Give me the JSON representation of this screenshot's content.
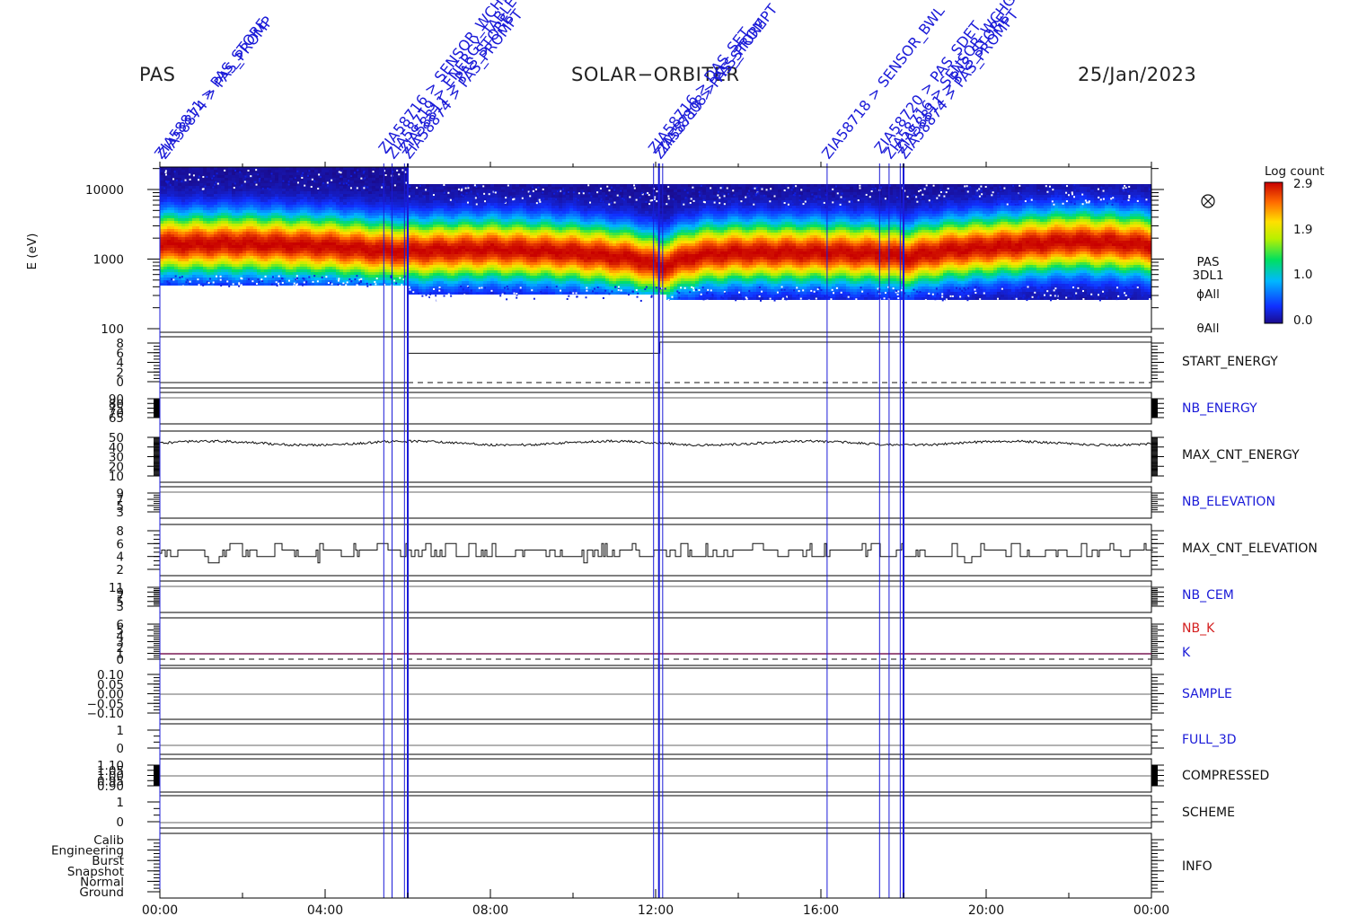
{
  "header": {
    "left": "PAS",
    "center": "SOLAR−ORBITER",
    "right": "25/Jan/2023"
  },
  "colors": {
    "axis": "#000000",
    "command_lines": "#1a1ad8",
    "label_black": "#111111",
    "label_blue": "#1a1ad8",
    "label_red": "#d42020",
    "k_line": "#7a1a55"
  },
  "chart_data": {
    "type": "heatmap",
    "time_axis": {
      "range": [
        "00:00",
        "24:00"
      ],
      "tick_labels": [
        "00:00",
        "04:00",
        "08:00",
        "12:00",
        "16:00",
        "20:00",
        "00:00"
      ]
    },
    "spectrogram": {
      "ylabel": "E (eV)",
      "scale": "log",
      "ylim": [
        100,
        20000
      ],
      "tick_labels": [
        "10000",
        "1000",
        "100"
      ],
      "side_labels": [
        "PAS",
        "3DL1",
        "ϕAll",
        "θAll"
      ],
      "side_icon": "circled-x-icon",
      "colorbar": {
        "title": "Log count",
        "range": [
          0.0,
          2.9
        ],
        "tick_labels": [
          "2.9",
          "1.9",
          "1.0",
          "0.0"
        ],
        "colormap": "rainbow"
      },
      "peak_energy_eV": {
        "hours": [
          0,
          2,
          4,
          5.5,
          8,
          10,
          11.5,
          12.1,
          13,
          14,
          16,
          17.5,
          18,
          19,
          20,
          21,
          22,
          23,
          24
        ],
        "values": [
          1700,
          1750,
          1600,
          1350,
          1450,
          1300,
          1050,
          800,
          1200,
          1300,
          1300,
          1250,
          1100,
          1400,
          1550,
          1700,
          1900,
          1800,
          1650
        ]
      }
    },
    "panels": [
      {
        "label": "START_ENERGY",
        "label_color": "#111111",
        "tick_labels": [
          "8",
          "6",
          "4",
          "2",
          "0"
        ],
        "ylim": [
          0,
          8
        ]
      },
      {
        "label": "NB_ENERGY",
        "label_color": "#1a1ad8",
        "tick_labels": [
          "90",
          "80",
          "75",
          "70",
          "65"
        ],
        "ylim": [
          64,
          91
        ]
      },
      {
        "label": "MAX_CNT_ENERGY",
        "label_color": "#111111",
        "tick_labels": [
          "50",
          "40",
          "30",
          "20",
          "10"
        ],
        "ylim": [
          10,
          50
        ]
      },
      {
        "label": "NB_ELEVATION",
        "label_color": "#1a1ad8",
        "tick_labels": [
          "9",
          "7",
          "5",
          "3"
        ],
        "ylim": [
          3,
          9
        ]
      },
      {
        "label": "MAX_CNT_ELEVATION",
        "label_color": "#111111",
        "tick_labels": [
          "8",
          "6",
          "4",
          "2"
        ],
        "ylim": [
          2,
          8
        ]
      },
      {
        "label": "NB_CEM",
        "label_color": "#1a1ad8",
        "tick_labels": [
          "11",
          "9",
          "7",
          "5",
          "3"
        ],
        "ylim": [
          3,
          11
        ]
      },
      {
        "label": "NB_K",
        "label_color": "#d42020",
        "second_label": "K",
        "second_label_color": "#1a1ad8",
        "tick_labels": [
          "6",
          "5",
          "4",
          "3",
          "2",
          "1",
          "0"
        ],
        "ylim": [
          0,
          6
        ]
      },
      {
        "label": "SAMPLE",
        "label_color": "#1a1ad8",
        "tick_labels": [
          "0.10",
          "0.05",
          "0.00",
          "−0.05",
          "−0.10"
        ],
        "ylim": [
          -0.1,
          0.1
        ]
      },
      {
        "label": "FULL_3D",
        "label_color": "#1a1ad8",
        "tick_labels": [
          "1",
          "0"
        ],
        "ylim": [
          0,
          1
        ]
      },
      {
        "label": "COMPRESSED",
        "label_color": "#111111",
        "tick_labels": [
          "1.10",
          "1.05",
          "1.00",
          "0.95",
          "0.90"
        ],
        "ylim": [
          0.9,
          1.1
        ]
      },
      {
        "label": "SCHEME",
        "label_color": "#111111",
        "tick_labels": [
          "1",
          "0"
        ],
        "ylim": [
          0,
          1
        ]
      },
      {
        "label": "INFO",
        "label_color": "#111111",
        "tick_labels": [
          "Calib",
          "Engineering",
          "Burst",
          "Snapshot",
          "Normal",
          "Ground"
        ]
      }
    ],
    "series": {
      "start_energy_hours": [
        0,
        6.0,
        6.0,
        12.1,
        12.1,
        18.0,
        18.0,
        24
      ],
      "start_energy_values": [
        0,
        0,
        5.8,
        5.8,
        8.0,
        8.0,
        8.0,
        8.0
      ],
      "max_cnt_energy_base": 44,
      "max_cnt_elevation_base": 4.5,
      "k_value": 1
    },
    "command_markers": [
      {
        "hour": 0.0,
        "label": "ZIA58811 > PAS_STORE",
        "label2": "ZIA58874 > PAS_PROMP"
      },
      {
        "hour": 5.42,
        "label": "ZIA58716 > SENSOR_WCHG"
      },
      {
        "hour": 5.62,
        "label": "ZIA58719 > ENERGY_TABLE"
      },
      {
        "hour": 5.92,
        "label": "ZIA58811 > PAS_STORE"
      },
      {
        "hour": 6.0,
        "label": "ZIA58874 > PAS_PROMPT"
      },
      {
        "hour": 11.95,
        "label": "ZIA58716 > DAS_SET"
      },
      {
        "hour": 12.08,
        "label": "ZIA58719 > PAS_STORE"
      },
      {
        "hour": 12.17,
        "label": "ZIA58808 > PAS_PROMPT"
      },
      {
        "hour": 16.15,
        "label": "ZIA58718 > SENSOR_BWL"
      },
      {
        "hour": 17.42,
        "label": "ZIA58720 > PAS_SDET"
      },
      {
        "hour": 17.65,
        "label": "ZIA58716 > SENSOR_WCHG"
      },
      {
        "hour": 17.92,
        "label": "ZIA58811 > PAS_STORE"
      },
      {
        "hour": 18.0,
        "label": "ZIA58874 > PAS_PROMPT"
      }
    ]
  }
}
